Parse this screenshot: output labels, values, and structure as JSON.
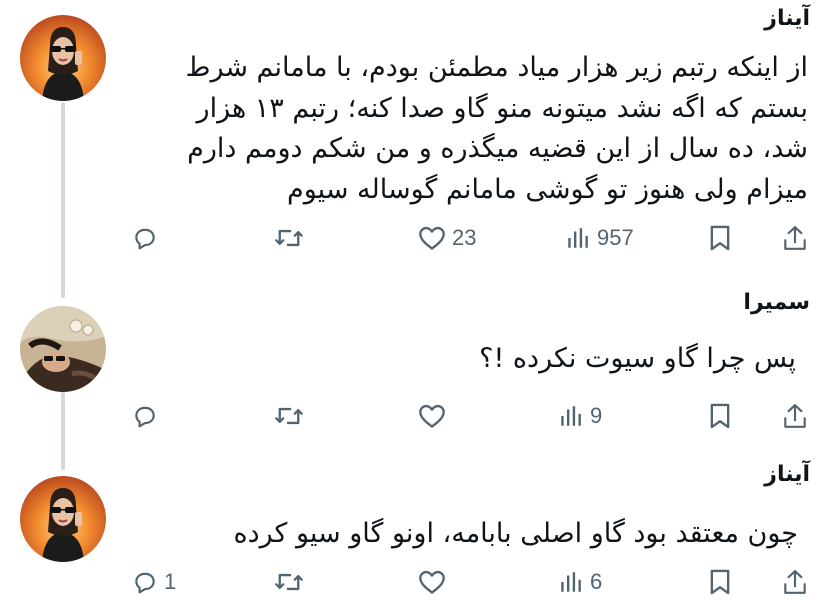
{
  "tweets": [
    {
      "author": "آیناز",
      "lines": [
        "از اینکه رتبم زیر هزار میاد مطمئن بودم، با مامانم شرط",
        "بستم که اگه نشد میتونه منو گاو صدا کنه؛ رتبم ۱۳ هزار",
        "شد، ده سال از این قضیه میگذره و من شکم دومم دارم",
        "میزام ولی هنوز تو گوشی مامانم گوساله سیوم"
      ],
      "reply_count": "",
      "like_count": "23",
      "view_count": "957",
      "avatar": "avatar-sunglasses-fire"
    },
    {
      "author": "سمیرا",
      "lines": [
        "پس چرا گاو سیوت نکرده !؟"
      ],
      "reply_count": "",
      "like_count": "",
      "view_count": "9",
      "avatar": "avatar-reclining-sunglasses"
    },
    {
      "author": "آیناز",
      "lines": [
        "چون معتقد بود گاو اصلی بابامه، اونو گاو سیو کرده"
      ],
      "reply_count": "1",
      "like_count": "",
      "view_count": "6",
      "avatar": "avatar-sunglasses-fire"
    }
  ],
  "icons": {
    "reply": "reply-icon",
    "retweet": "retweet-icon",
    "like": "heart-icon",
    "views": "views-icon",
    "bookmark": "bookmark-icon",
    "share": "share-icon"
  },
  "colors": {
    "text": "#0f1419",
    "muted": "#536471",
    "thread_line": "#cfd9de"
  }
}
